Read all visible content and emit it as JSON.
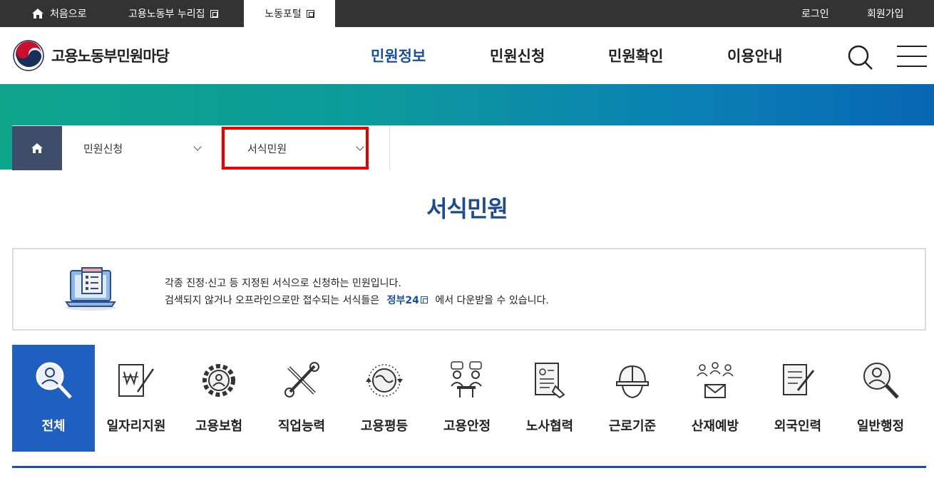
{
  "topbar": {
    "home": "처음으로",
    "nuri": "고용노동부 누리집",
    "portal": "노동포털",
    "login": "로그인",
    "signup": "회원가입"
  },
  "header": {
    "logo_text": "고용노동부민원마당",
    "nav": [
      "민원정보",
      "민원신청",
      "민원확인",
      "이용안내"
    ],
    "active_nav": "민원정보"
  },
  "breadcrumb": {
    "level1": "민원신청",
    "level2": "서식민원"
  },
  "page_title": "서식민원",
  "info": {
    "line1": "각종 진정·신고 등 지정된 서식으로 신청하는 민원입니다.",
    "line2_before": "검색되지 않거나 오프라인으로만 접수되는 서식들은",
    "line2_link": "정부24",
    "line2_after": "에서 다운받을 수 있습니다."
  },
  "categories": [
    {
      "label": "전체",
      "icon": "person-magnifier-icon",
      "active": true
    },
    {
      "label": "일자리지원",
      "icon": "won-document-pen-icon",
      "active": false
    },
    {
      "label": "고용보험",
      "icon": "person-gear-icon",
      "active": false
    },
    {
      "label": "직업능력",
      "icon": "wrench-screwdriver-icon",
      "active": false
    },
    {
      "label": "고용평등",
      "icon": "globe-arrows-icon",
      "active": false
    },
    {
      "label": "고용안정",
      "icon": "meeting-people-icon",
      "active": false
    },
    {
      "label": "노사협력",
      "icon": "document-hand-icon",
      "active": false
    },
    {
      "label": "근로기준",
      "icon": "hard-hat-icon",
      "active": false
    },
    {
      "label": "산재예방",
      "icon": "people-mail-icon",
      "active": false
    },
    {
      "label": "외국인력",
      "icon": "document-pen-icon",
      "active": false
    },
    {
      "label": "일반행정",
      "icon": "person-magnifier-icon",
      "active": false
    }
  ],
  "colors": {
    "brand_blue": "#1a4fa0",
    "active_tab": "#1f5fbf",
    "highlight_box": "#e60000"
  }
}
